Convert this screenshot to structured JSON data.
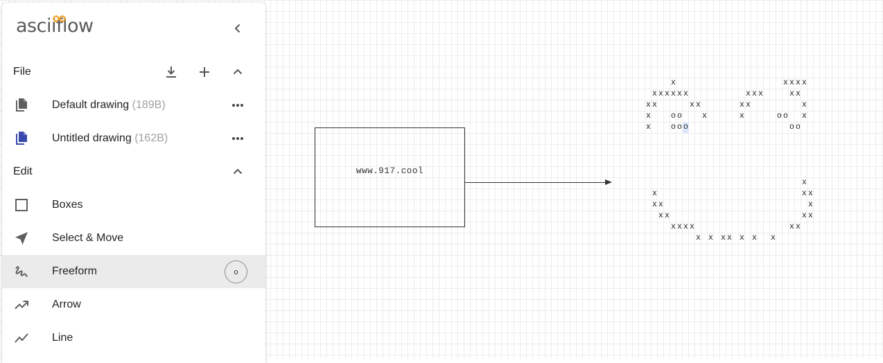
{
  "app": {
    "logo_text": "asciiflow"
  },
  "file_section": {
    "title": "File",
    "drawings": [
      {
        "name": "Default drawing",
        "size": "(189B)",
        "active": false
      },
      {
        "name": "Untitled drawing",
        "size": "(162B)",
        "active": true
      }
    ]
  },
  "edit_section": {
    "title": "Edit",
    "tools": [
      {
        "label": "Boxes",
        "icon": "square-outline-icon"
      },
      {
        "label": "Select & Move",
        "icon": "navigation-arrow-icon"
      },
      {
        "label": "Freeform",
        "icon": "gesture-icon",
        "shortcut": "o",
        "selected": true
      },
      {
        "label": "Arrow",
        "icon": "trending-up-arrow-icon"
      },
      {
        "label": "Line",
        "icon": "show-chart-icon"
      }
    ]
  },
  "canvas": {
    "box_text": "www.917.cool",
    "art_rows": [
      {
        "row": 7,
        "text": "      x                 xxxx"
      },
      {
        "row": 8,
        "text": "   xxxxxx         xxx    xx"
      },
      {
        "row": 9,
        "text": "  xx     xx      xx        x"
      },
      {
        "row": 10,
        "text": "  x   oo   x     x     oo  x"
      },
      {
        "row": 11,
        "text": "  x   ooo                oo"
      },
      {
        "row": 16,
        "text": "                           x"
      },
      {
        "row": 17,
        "text": "   x                       xx"
      },
      {
        "row": 18,
        "text": "   xx                       x"
      },
      {
        "row": 19,
        "text": "    xx                     xx"
      },
      {
        "row": 20,
        "text": "      xxxx               xx"
      },
      {
        "row": 21,
        "text": "          x x xx x x  x"
      }
    ]
  },
  "colors": {
    "accent_orange": "#f0a02a",
    "active_file_blue": "#3949ab",
    "icon_gray": "#5f5f5f",
    "selected_row_bg": "#ebebeb"
  }
}
